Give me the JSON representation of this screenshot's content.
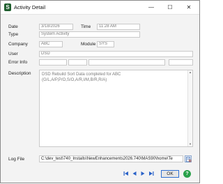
{
  "window": {
    "title": "Activity Detail",
    "app_icon": "S",
    "minimize": "—",
    "maximize": "☐",
    "close": "✕"
  },
  "fields": {
    "date_label": "Date",
    "date_value": "3/18/2026",
    "time_label": "Time",
    "time_value": "11:28 AM",
    "type_label": "Type",
    "type_value": "System Activity",
    "company_label": "Company",
    "company_value": "ABC",
    "module_label": "Module",
    "module_value": "SYS",
    "user_label": "User",
    "user_value": "DSD",
    "error_info_label": "Error Info",
    "error_info_values": [
      "",
      "",
      "",
      ""
    ],
    "description_label": "Description",
    "description_value": "DSD Rebuild Sort Data completed for ABC (G/L,A/P,P/O,S/O,A/R,I/M,B/R,R/A)",
    "logfile_label": "Log File",
    "logfile_value": "C:\\dev_test\\740_Installs\\NewEnhancements2026.740\\MAS90\\home\\Te"
  },
  "footer": {
    "ok_label": "OK",
    "help_label": "?"
  },
  "colors": {
    "accent": "#2f6fd1",
    "nav_blue": "#2a62c8",
    "help_green": "#2aa14a",
    "app_icon_green": "#1f5e2e"
  }
}
